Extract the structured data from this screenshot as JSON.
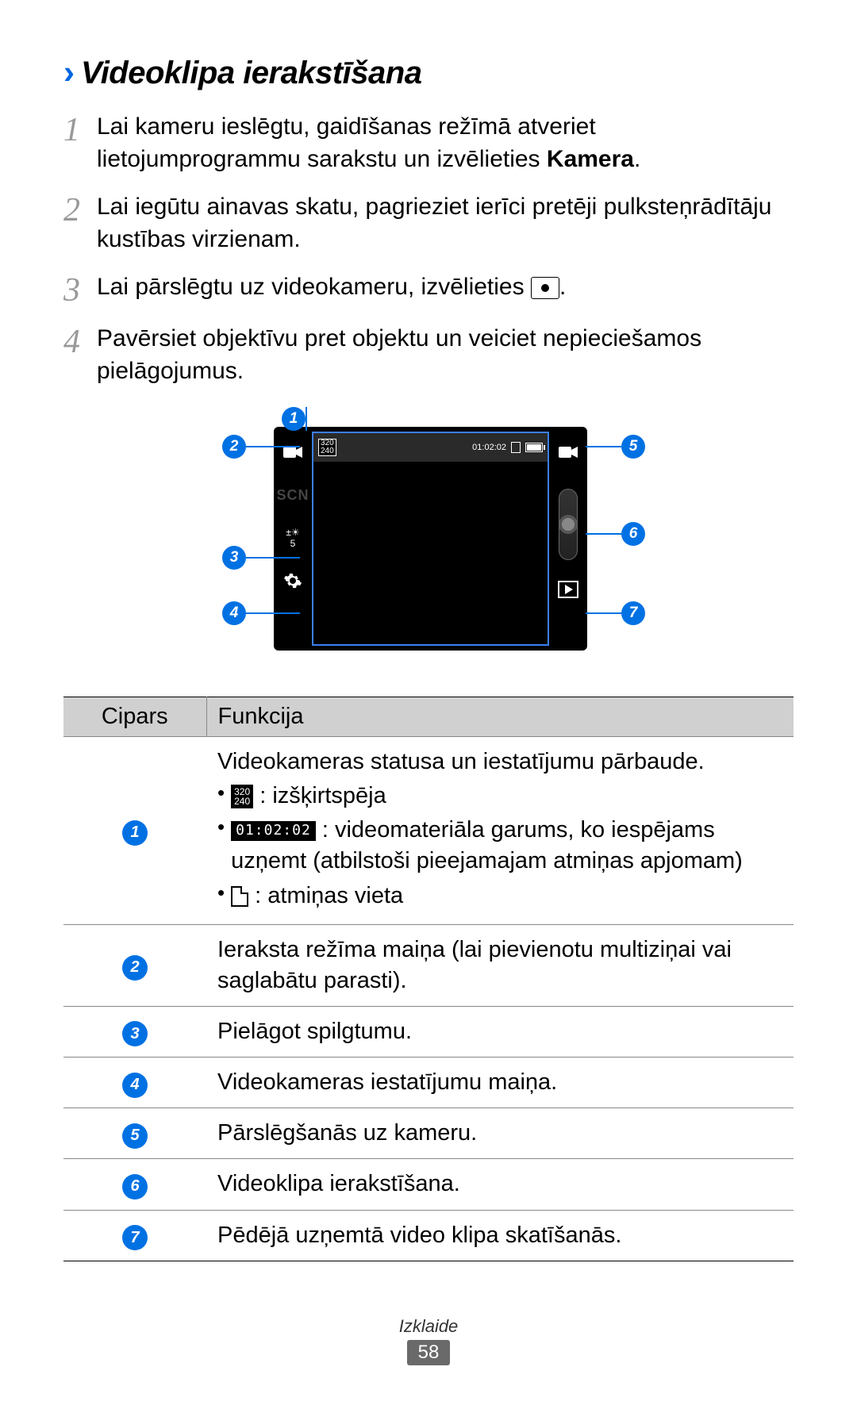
{
  "heading": "Videoklipa ierakstīšana",
  "steps": [
    {
      "num": "1",
      "text_before": "Lai kameru ieslēgtu, gaidīšanas režīmā atveriet lietojumprogrammu sarakstu un izvēlieties ",
      "bold": "Kamera",
      "text_after": "."
    },
    {
      "num": "2",
      "text": "Lai iegūtu ainavas skatu, pagrieziet ierīci pretēji pulksteņrādītāju kustības virzienam."
    },
    {
      "num": "3",
      "text_before": "Lai pārslēgtu uz videokameru, izvēlieties ",
      "icon": true,
      "text_after": "."
    },
    {
      "num": "4",
      "text": "Pavērsiet objektīvu pret objektu un veiciet nepieciešamos pielāgojumus."
    }
  ],
  "diagram": {
    "resolution": "320\n240",
    "time": "01:02:02",
    "scn": "SCN",
    "ev_value": "5",
    "callouts": [
      "1",
      "2",
      "3",
      "4",
      "5",
      "6",
      "7"
    ]
  },
  "table": {
    "headers": [
      "Cipars",
      "Funkcija"
    ],
    "rows": [
      {
        "num": "1",
        "intro": "Videokameras statusa un iestatījumu pārbaude.",
        "bullets": [
          {
            "icon": "res",
            "text": ": izšķirtspēja"
          },
          {
            "icon": "time",
            "text": ": videomateriāla garums, ko iespējams uzņemt (atbilstoši pieejamajam atmiņas apjomam)"
          },
          {
            "icon": "sd",
            "text": ": atmiņas vieta"
          }
        ]
      },
      {
        "num": "2",
        "text": "Ieraksta režīma maiņa (lai pievienotu multiziņai vai saglabātu parasti)."
      },
      {
        "num": "3",
        "text": "Pielāgot spilgtumu."
      },
      {
        "num": "4",
        "text": "Videokameras iestatījumu maiņa."
      },
      {
        "num": "5",
        "text": "Pārslēgšanās uz kameru."
      },
      {
        "num": "6",
        "text": "Videoklipa ierakstīšana."
      },
      {
        "num": "7",
        "text": "Pēdējā uzņemtā video klipa skatīšanās."
      }
    ]
  },
  "footer": {
    "section": "Izklaide",
    "page": "58"
  },
  "mini_time": "01:02:02",
  "mini_res": "320\n240"
}
